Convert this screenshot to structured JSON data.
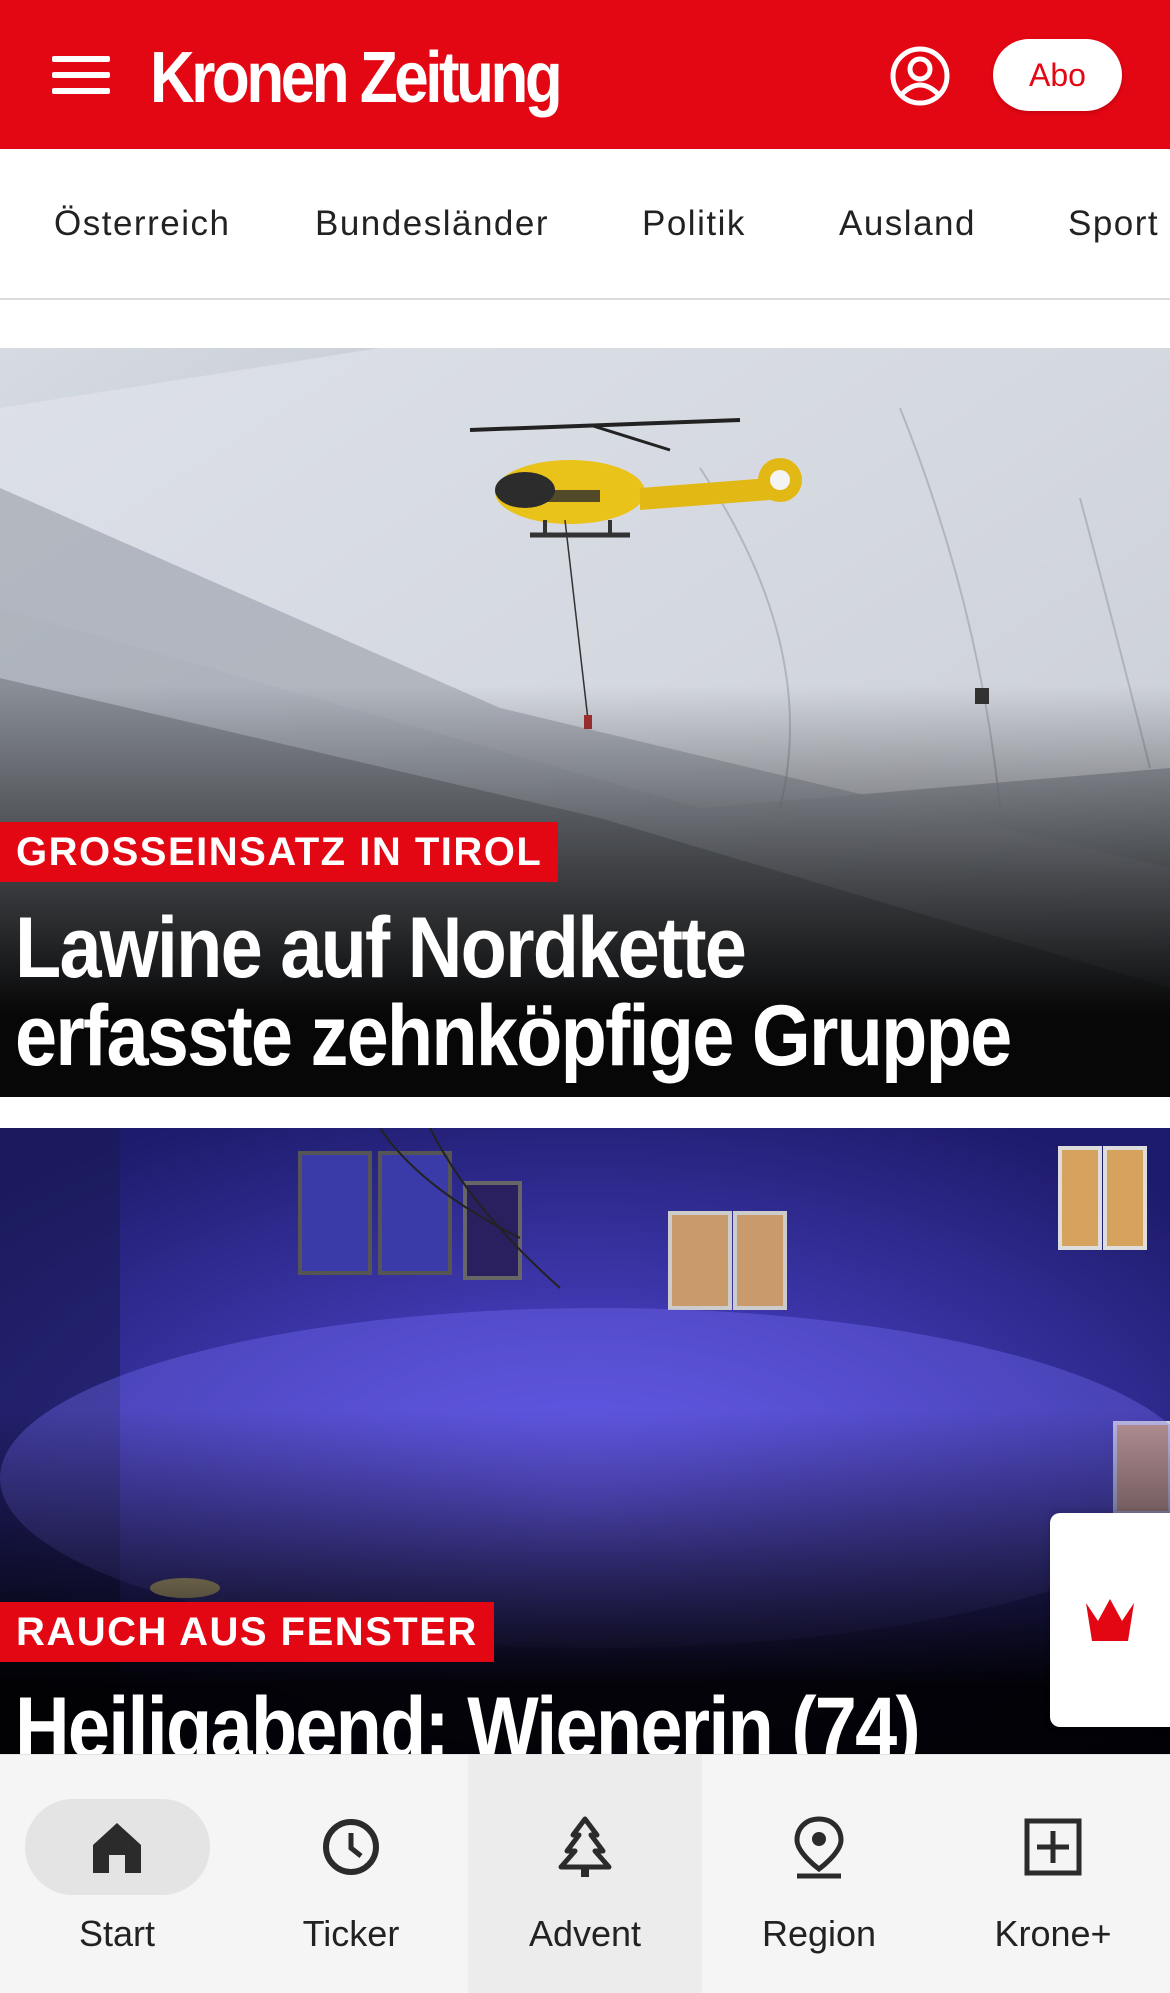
{
  "header": {
    "logo": "Kronen Zeitung",
    "subscribe_label": "Abo",
    "brand_color": "#e30613"
  },
  "categories": [
    "Österreich",
    "Bundesländer",
    "Politik",
    "Ausland",
    "Sport"
  ],
  "articles": [
    {
      "kicker": "GROSSEINSATZ IN TIROL",
      "title_line1": "Lawine auf Nordkette",
      "title_line2": "erfasste zehnköpfige Gruppe",
      "image": "helicopter-over-avalanche"
    },
    {
      "kicker": "RAUCH AUS FENSTER",
      "title_line1": "Heiligabend: Wienerin (74)",
      "image": "smoke-building-blue-light"
    }
  ],
  "floating": {
    "icon": "krone-crown-icon"
  },
  "bottom_nav": {
    "items": [
      {
        "label": "Start",
        "icon": "home-icon",
        "active": true
      },
      {
        "label": "Ticker",
        "icon": "clock-icon"
      },
      {
        "label": "Advent",
        "icon": "tree-icon"
      },
      {
        "label": "Region",
        "icon": "location-pin-icon"
      },
      {
        "label": "Krone+",
        "icon": "plus-box-icon"
      }
    ]
  }
}
